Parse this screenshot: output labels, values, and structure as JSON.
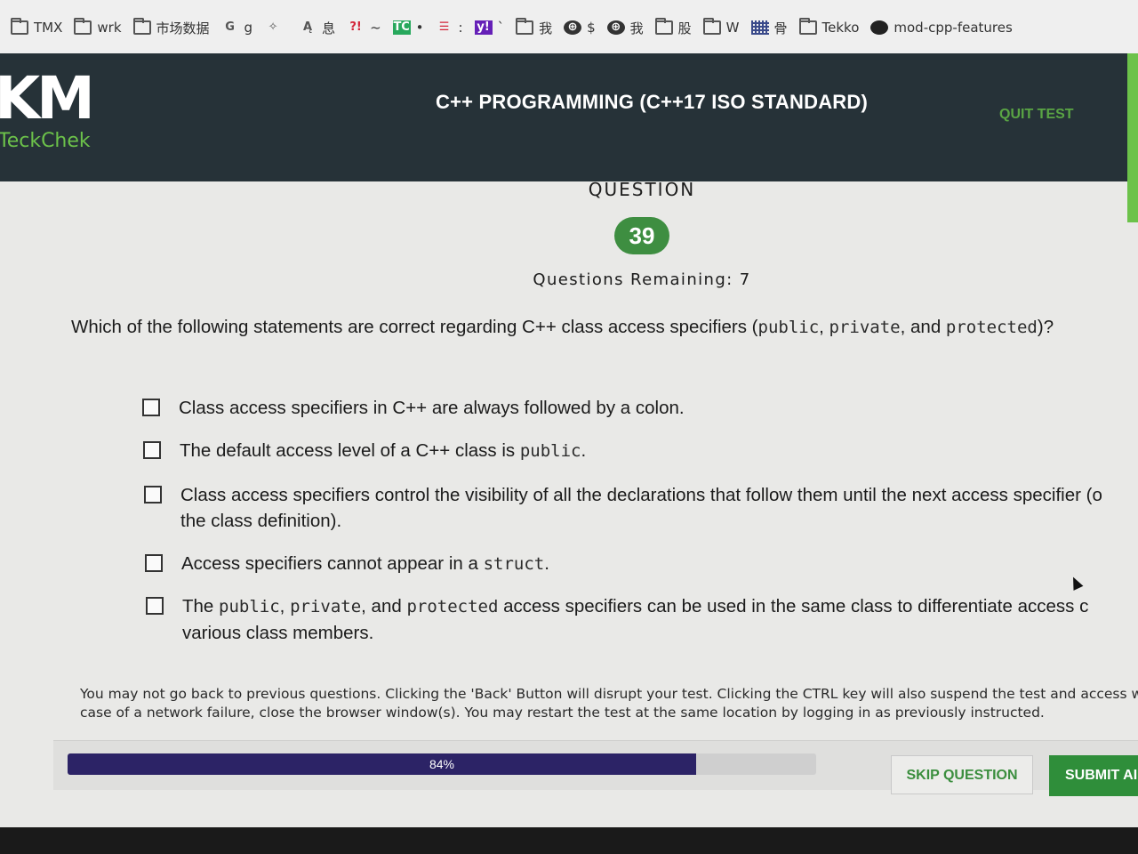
{
  "bookmarks": [
    {
      "label": "TMX",
      "icon": "folder-icon"
    },
    {
      "label": "wrk",
      "icon": "folder-icon"
    },
    {
      "label": "市场数据",
      "icon": "folder-icon"
    },
    {
      "label": "g",
      "icon": "google-icon",
      "glyph": "G"
    },
    {
      "label": "",
      "icon": "seal-icon",
      "glyph": "✧"
    },
    {
      "label": "息",
      "icon": "arrow-logo-icon",
      "glyph": "Ą"
    },
    {
      "label": "~",
      "icon": "exclaim-icon",
      "glyph": "?!"
    },
    {
      "label": "•",
      "icon": "tc-icon",
      "glyph": "TC"
    },
    {
      "label": ":",
      "icon": "e-logo-icon",
      "glyph": "☰"
    },
    {
      "label": "`",
      "icon": "yahoo-icon",
      "glyph": "y!"
    },
    {
      "label": "我",
      "icon": "folder-icon"
    },
    {
      "label": "$",
      "icon": "globe-icon",
      "glyph": "⊕"
    },
    {
      "label": "我",
      "icon": "globe-icon",
      "glyph": "⊕"
    },
    {
      "label": "股",
      "icon": "folder-icon"
    },
    {
      "label": "W",
      "icon": "folder-icon"
    },
    {
      "label": "骨",
      "icon": "grid-icon"
    },
    {
      "label": "Tekko",
      "icon": "folder-icon"
    },
    {
      "label": "mod-cpp-features",
      "icon": "github-icon"
    }
  ],
  "header": {
    "logo_mark": "KM",
    "logo_text": "TeckChek",
    "title": "C++ PROGRAMMING (C++17 ISO STANDARD)",
    "quit_label": "QUIT TEST"
  },
  "question": {
    "label": "QUESTION",
    "number": "39",
    "remaining_label": "Questions Remaining:",
    "remaining": "7",
    "stem": {
      "before": "Which of the following statements are correct regarding C++ class access specifiers (",
      "code1": "public",
      "sep1": ", ",
      "code2": "private",
      "sep2": ", and ",
      "code3": "protected",
      "after": ")?"
    },
    "options": [
      {
        "text": "Class access specifiers in C++ are always followed by a colon."
      },
      {
        "before": "The default access level of a C++ class is ",
        "code": "public",
        "after": "."
      },
      {
        "line1": "Class access specifiers control the visibility of all the declarations that follow them until the next access specifier (o",
        "line2": "the class definition)."
      },
      {
        "before": "Access specifiers cannot appear in a ",
        "code": "struct",
        "after": "."
      },
      {
        "before": "The ",
        "code1": "public",
        "sep1": ", ",
        "code2": "private",
        "sep2": ", and ",
        "code3": "protected",
        "line1_after": " access specifiers can be used in the same class to differentiate access c",
        "line2": "various class members."
      }
    ]
  },
  "notice": {
    "line1": "You may not go back to previous questions. Clicking the 'Back' Button will disrupt your test. Clicking the CTRL key will also suspend the test and access will be c",
    "line2": "case of a network failure, close the browser window(s). You may restart the test at the same location by logging in as previously instructed."
  },
  "progress": {
    "label": "84%",
    "value": 0.84
  },
  "buttons": {
    "skip": "SKIP QUESTION",
    "submit": "SUBMIT AI"
  },
  "colors": {
    "header_bg": "#263238",
    "accent_green": "#6cc24a",
    "progress_fill": "#2c2366"
  }
}
